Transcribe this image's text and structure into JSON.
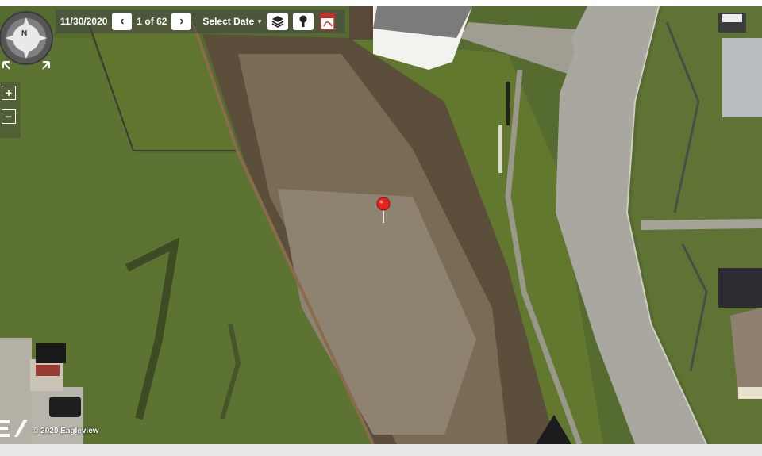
{
  "toolbar": {
    "date": "11/30/2020",
    "page_counter": "1 of 62",
    "select_date_label": "Select Date",
    "prev_symbol": "‹",
    "next_symbol": "›"
  },
  "compass": {
    "north_label": "N"
  },
  "zoom": {
    "in_symbol": "+",
    "out_symbol": "−"
  },
  "footer": {
    "copyright": "© 2020 Eagleview"
  },
  "icons": [
    "chevron-left-icon",
    "chevron-right-icon",
    "layers-icon",
    "keyhole-icon",
    "pdf-icon",
    "compass-icon",
    "location-pin-icon",
    "eagleview-logo-icon"
  ],
  "colors": {
    "lawn": "#566b2f",
    "road": "#a9a7a0",
    "pin": "#e0241b",
    "toolbar": "#464646"
  }
}
